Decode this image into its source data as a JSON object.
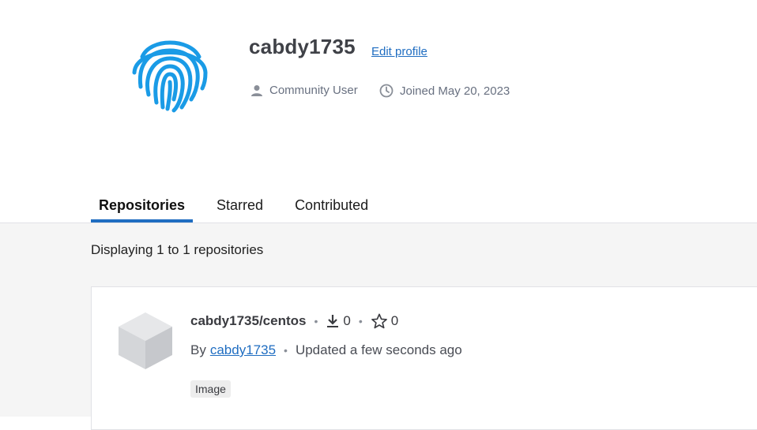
{
  "profile": {
    "username": "cabdy1735",
    "edit_label": "Edit profile",
    "role": "Community User",
    "joined": "Joined May 20, 2023",
    "avatar_icon": "fingerprint-icon",
    "accent_color": "#1a9be6"
  },
  "tabs": [
    {
      "label": "Repositories",
      "active": true
    },
    {
      "label": "Starred",
      "active": false
    },
    {
      "label": "Contributed",
      "active": false
    }
  ],
  "listing": {
    "displaying": "Displaying 1 to 1 repositories"
  },
  "repo": {
    "name": "cabdy1735/centos",
    "downloads": "0",
    "stars": "0",
    "by_prefix": "By",
    "author": "cabdy1735",
    "updated": "Updated a few seconds ago",
    "badge": "Image",
    "icon": "cube-icon"
  },
  "colors": {
    "link": "#1f6dc1",
    "tab_underline": "#1f6dc1"
  }
}
